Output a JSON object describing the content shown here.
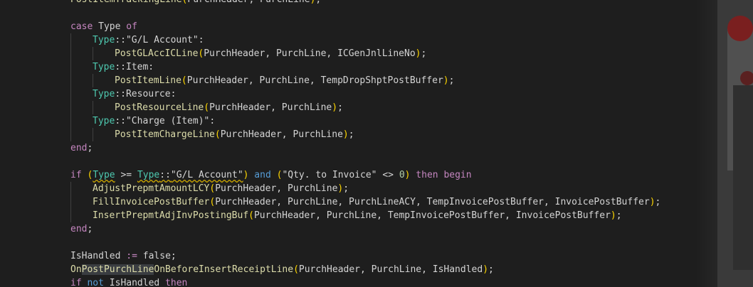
{
  "editor": {
    "lines": [
      {
        "tokens": [
          {
            "t": "PostItemTrackingLine",
            "c": "fn"
          },
          {
            "t": "(",
            "c": "br1"
          },
          {
            "t": "PurchHeader, PurchLine",
            "c": "plain"
          },
          {
            "t": ")",
            "c": "br1"
          },
          {
            "t": ";",
            "c": "plain"
          }
        ],
        "indent": 1
      },
      {
        "tokens": [],
        "indent": 0
      },
      {
        "tokens": [
          {
            "t": "case ",
            "c": "kw"
          },
          {
            "t": "Type",
            "c": "plain"
          },
          {
            "t": " of",
            "c": "kw"
          }
        ],
        "indent": 1
      },
      {
        "tokens": [
          {
            "t": "Type",
            "c": "ty"
          },
          {
            "t": "::",
            "c": "plain"
          },
          {
            "t": "\"G/L Account\"",
            "c": "plain"
          },
          {
            "t": ":",
            "c": "plain"
          }
        ],
        "indent": 2
      },
      {
        "tokens": [
          {
            "t": "PostGLAccICLine",
            "c": "fn"
          },
          {
            "t": "(",
            "c": "br1"
          },
          {
            "t": "PurchHeader, PurchLine, ICGenJnlLineNo",
            "c": "plain"
          },
          {
            "t": ")",
            "c": "br1"
          },
          {
            "t": ";",
            "c": "plain"
          }
        ],
        "indent": 3
      },
      {
        "tokens": [
          {
            "t": "Type",
            "c": "ty"
          },
          {
            "t": "::",
            "c": "plain"
          },
          {
            "t": "Item",
            "c": "plain"
          },
          {
            "t": ":",
            "c": "plain"
          }
        ],
        "indent": 2
      },
      {
        "tokens": [
          {
            "t": "PostItemLine",
            "c": "fn"
          },
          {
            "t": "(",
            "c": "br1"
          },
          {
            "t": "PurchHeader, PurchLine, TempDropShptPostBuffer",
            "c": "plain"
          },
          {
            "t": ")",
            "c": "br1"
          },
          {
            "t": ";",
            "c": "plain"
          }
        ],
        "indent": 3
      },
      {
        "tokens": [
          {
            "t": "Type",
            "c": "ty"
          },
          {
            "t": "::",
            "c": "plain"
          },
          {
            "t": "Resource",
            "c": "plain"
          },
          {
            "t": ":",
            "c": "plain"
          }
        ],
        "indent": 2
      },
      {
        "tokens": [
          {
            "t": "PostResourceLine",
            "c": "fn"
          },
          {
            "t": "(",
            "c": "br1"
          },
          {
            "t": "PurchHeader, PurchLine",
            "c": "plain"
          },
          {
            "t": ")",
            "c": "br1"
          },
          {
            "t": ";",
            "c": "plain"
          }
        ],
        "indent": 3
      },
      {
        "tokens": [
          {
            "t": "Type",
            "c": "ty"
          },
          {
            "t": "::",
            "c": "plain"
          },
          {
            "t": "\"Charge (Item)\"",
            "c": "plain"
          },
          {
            "t": ":",
            "c": "plain"
          }
        ],
        "indent": 2
      },
      {
        "tokens": [
          {
            "t": "PostItemChargeLine",
            "c": "fn"
          },
          {
            "t": "(",
            "c": "br1"
          },
          {
            "t": "PurchHeader, PurchLine",
            "c": "plain"
          },
          {
            "t": ")",
            "c": "br1"
          },
          {
            "t": ";",
            "c": "plain"
          }
        ],
        "indent": 3
      },
      {
        "tokens": [
          {
            "t": "end",
            "c": "kw"
          },
          {
            "t": ";",
            "c": "plain"
          }
        ],
        "indent": 1
      },
      {
        "tokens": [],
        "indent": 0
      },
      {
        "tokens": [
          {
            "t": "if ",
            "c": "kw"
          },
          {
            "t": "(",
            "c": "br1"
          },
          {
            "t": "Type",
            "c": "ty",
            "sq": true
          },
          {
            "t": " >= ",
            "c": "plain"
          },
          {
            "t": "Type",
            "c": "ty",
            "sq": true
          },
          {
            "t": "::",
            "c": "plain",
            "sq": true
          },
          {
            "t": "\"G/L Account\"",
            "c": "plain",
            "sq": true
          },
          {
            "t": ")",
            "c": "br1"
          },
          {
            "t": " and ",
            "c": "bl"
          },
          {
            "t": "(",
            "c": "br1"
          },
          {
            "t": "\"Qty. to Invoice\"",
            "c": "plain"
          },
          {
            "t": " <> ",
            "c": "plain"
          },
          {
            "t": "0",
            "c": "nm"
          },
          {
            "t": ")",
            "c": "br1"
          },
          {
            "t": " then begin",
            "c": "kw"
          }
        ],
        "indent": 1
      },
      {
        "tokens": [
          {
            "t": "AdjustPrepmtAmountLCY",
            "c": "fn"
          },
          {
            "t": "(",
            "c": "br1"
          },
          {
            "t": "PurchHeader, PurchLine",
            "c": "plain"
          },
          {
            "t": ")",
            "c": "br1"
          },
          {
            "t": ";",
            "c": "plain"
          }
        ],
        "indent": 2
      },
      {
        "tokens": [
          {
            "t": "FillInvoicePostBuffer",
            "c": "fn"
          },
          {
            "t": "(",
            "c": "br1"
          },
          {
            "t": "PurchHeader, PurchLine, PurchLineACY, TempInvoicePostBuffer, InvoicePostBuffer",
            "c": "plain"
          },
          {
            "t": ")",
            "c": "br1"
          },
          {
            "t": ";",
            "c": "plain"
          }
        ],
        "indent": 2
      },
      {
        "tokens": [
          {
            "t": "InsertPrepmtAdjInvPostingBuf",
            "c": "fn"
          },
          {
            "t": "(",
            "c": "br1"
          },
          {
            "t": "PurchHeader, PurchLine, TempInvoicePostBuffer, InvoicePostBuffer",
            "c": "plain"
          },
          {
            "t": ")",
            "c": "br1"
          },
          {
            "t": ";",
            "c": "plain"
          }
        ],
        "indent": 2
      },
      {
        "tokens": [
          {
            "t": "end",
            "c": "kw"
          },
          {
            "t": ";",
            "c": "plain"
          }
        ],
        "indent": 1
      },
      {
        "tokens": [],
        "indent": 0
      },
      {
        "tokens": [
          {
            "t": "IsHandled",
            "c": "plain"
          },
          {
            "t": " := ",
            "c": "kw"
          },
          {
            "t": "false",
            "c": "plain"
          },
          {
            "t": ";",
            "c": "plain"
          }
        ],
        "indent": 1
      },
      {
        "tokens": [
          {
            "t": "On",
            "c": "fn"
          },
          {
            "t": "PostPurchLine",
            "c": "fn",
            "hl": true
          },
          {
            "t": "OnBeforeInsertReceiptLine",
            "c": "fn"
          },
          {
            "t": "(",
            "c": "br1"
          },
          {
            "t": "PurchHeader, PurchLine, IsHandled",
            "c": "plain"
          },
          {
            "t": ")",
            "c": "br1"
          },
          {
            "t": ";",
            "c": "plain"
          }
        ],
        "indent": 1
      },
      {
        "tokens": [
          {
            "t": "if ",
            "c": "kw"
          },
          {
            "t": "not ",
            "c": "bl"
          },
          {
            "t": "IsHandled",
            "c": "plain"
          },
          {
            "t": " then",
            "c": "kw"
          }
        ],
        "indent": 1
      }
    ]
  },
  "colors": {
    "background": "#1e1e1e",
    "keyword": "#c586c0",
    "function": "#dcdcaa",
    "type": "#4ec9b0",
    "bracket": "#ffd700",
    "number": "#b5cea8",
    "text": "#d4d4d4",
    "warning_squiggle": "#cca700"
  },
  "decor": {
    "right_edge_image": "dark-spiderman-wallpaper-icon"
  }
}
